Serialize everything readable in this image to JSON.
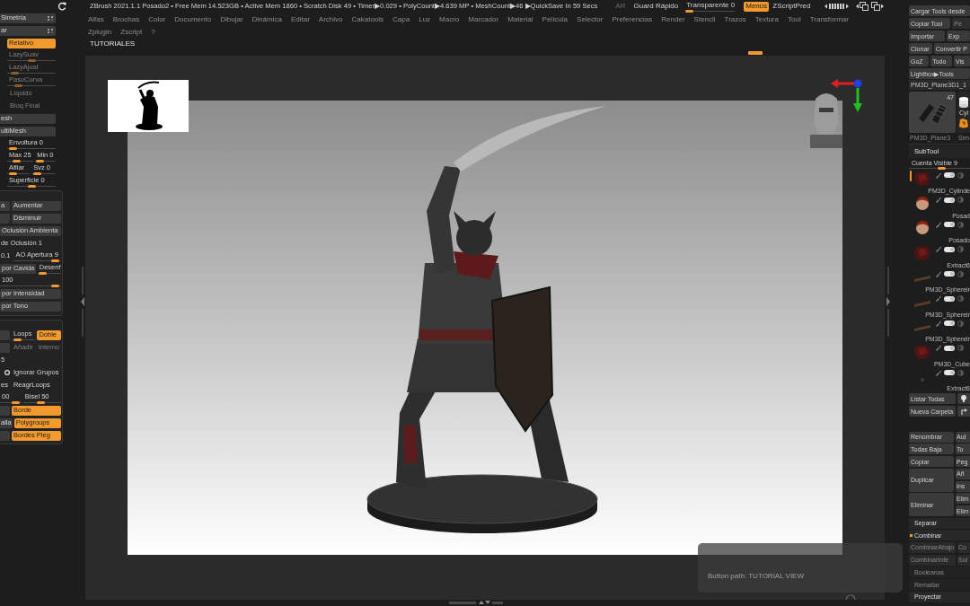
{
  "status_bar": {
    "text": "ZBrush 2021.1.1 Posado2 • Free Mem 14.523GB • Active Mem 1860 • Scratch Disk 49 • Timer▶0.029 • PolyCount▶4.639 MP • MeshCount▶46 ▶QuickSave In 59 Secs",
    "ar": {
      "label": "AR",
      "disabled": true
    },
    "quick_save": "Guard Rápido",
    "transparency": {
      "label": "Transparente 0",
      "level": 0
    },
    "menus": {
      "label": "Menús",
      "on": true
    },
    "zscript": "ZScriptPred"
  },
  "menu_bar": {
    "rows": [
      [
        "Alfas",
        "Brochas",
        "Color",
        "Documento",
        "Dibujar",
        "Dinámica",
        "Editar",
        "Archivo",
        "Cakatools",
        "Capa",
        "Luz",
        "Macro",
        "Marcador",
        "Material",
        "Película",
        "Selector",
        "Preferencias",
        "Render",
        "Stencil",
        "Trazos",
        "Textura",
        "Tool",
        "Transformar"
      ],
      [
        "Zplugin",
        "Zscript",
        "?"
      ]
    ]
  },
  "tab_label": "TUTORIALES",
  "left_tray": {
    "panels": [
      {
        "rows": [
          [
            {
              "kind": "title",
              "label": "Simetría"
            }
          ],
          [
            {
              "kind": "title",
              "label": "ar"
            }
          ],
          [
            {
              "kind": "toggle",
              "label": "Relativo",
              "on": true,
              "disabled": false
            }
          ],
          [
            {
              "kind": "slider",
              "label": "LazySuav",
              "level": 0.5,
              "disabled": true
            }
          ],
          [
            {
              "kind": "slider",
              "label": "LazyAjust",
              "level": 0.08,
              "disabled": true
            }
          ],
          [
            {
              "kind": "slider",
              "label": "PasoCurva",
              "level": 0.18,
              "disabled": true
            }
          ],
          [
            {
              "kind": "button",
              "label": "Líquido",
              "disabled": true
            }
          ],
          [
            {
              "kind": "button",
              "label": "Bloq Final",
              "disabled": true
            }
          ],
          [
            {
              "kind": "bar",
              "label": "esh"
            }
          ],
          [
            {
              "kind": "bar",
              "label": "ultiMesh"
            }
          ],
          [
            {
              "kind": "slider",
              "label": "Envoltura 0",
              "level": 0.05,
              "disabled": false
            }
          ],
          [
            {
              "kind": "slider",
              "label": "Max 25",
              "level": 0.3,
              "disabled": false
            },
            {
              "kind": "slider",
              "label": "Min 0",
              "level": 0.05,
              "disabled": false
            }
          ],
          [
            {
              "kind": "slider",
              "label": "Afilar",
              "level": 0.15,
              "disabled": false
            },
            {
              "kind": "slider",
              "label": "Svz 0",
              "level": 0.1,
              "disabled": false
            }
          ],
          [
            {
              "kind": "slider",
              "label": "Superficie 0",
              "level": 0.5,
              "disabled": false
            }
          ]
        ]
      },
      {
        "rows": [
          [
            {
              "kind": "stub",
              "label": "a"
            },
            {
              "kind": "button",
              "label": "Aumentar",
              "disabled": false
            }
          ],
          [
            {
              "kind": "stub"
            },
            {
              "kind": "button",
              "label": "Disminuir",
              "disabled": false
            }
          ],
          [
            {
              "kind": "button",
              "label": "Oclusión Ambienta",
              "disabled": false
            }
          ],
          [
            {
              "kind": "value",
              "label": "de Oclusión 1"
            }
          ],
          [
            {
              "kind": "value",
              "label": "0.1"
            },
            {
              "kind": "slider",
              "label": "AO Apertura 9",
              "level": 0.95,
              "disabled": false
            }
          ],
          [
            {
              "kind": "button",
              "label": "por Cavida",
              "disabled": false
            },
            {
              "kind": "slider",
              "label": "Desenf",
              "level": 0.1,
              "disabled": false
            }
          ],
          [
            {
              "kind": "slider",
              "label": "100",
              "level": 0.97,
              "disabled": false
            }
          ],
          [
            {
              "kind": "button",
              "label": "por Intensidad",
              "disabled": false
            }
          ],
          [
            {
              "kind": "button",
              "label": "por Tono",
              "disabled": false
            }
          ]
        ]
      },
      {
        "rows": [
          [
            {
              "kind": "stub"
            },
            {
              "kind": "slider",
              "label": "Loops",
              "level": 0.1,
              "disabled": false
            },
            {
              "kind": "toggle",
              "label": "Doble",
              "on": true,
              "disabled": false
            }
          ],
          [
            {
              "kind": "stub"
            },
            {
              "kind": "label",
              "label": "Añadir",
              "disabled": true
            },
            {
              "kind": "label",
              "label": "Interno",
              "disabled": true
            }
          ],
          [
            {
              "kind": "value",
              "label": "5"
            }
          ],
          [
            {
              "kind": "check",
              "checked": false
            },
            {
              "kind": "label",
              "label": "Ignorar Grupos",
              "disabled": false
            }
          ],
          [
            {
              "kind": "value",
              "label": "es"
            },
            {
              "kind": "label",
              "label": "ReagrLoops",
              "disabled": false
            }
          ],
          [
            {
              "kind": "slider",
              "label": "00",
              "level": 0.9,
              "disabled": false
            },
            {
              "kind": "slider",
              "label": "Bisel 50",
              "level": 0.45,
              "disabled": false
            }
          ],
          [
            {
              "kind": "stub"
            },
            {
              "kind": "toggle",
              "label": "Borde",
              "on": true,
              "disabled": false
            }
          ],
          [
            {
              "kind": "stub",
              "label": "alla"
            },
            {
              "kind": "toggle",
              "label": "Polygroups",
              "on": true,
              "disabled": false
            }
          ],
          [
            {
              "kind": "stub"
            },
            {
              "kind": "toggle",
              "label": "Bordes Pleg",
              "on": true,
              "disabled": false
            }
          ]
        ]
      }
    ]
  },
  "viewport": {
    "tooltip": "Button path: TUTORIAL VIEW"
  },
  "right_tray": {
    "tool_rows": [
      [
        {
          "label": "Cargar Tools desde",
          "disabled": false
        }
      ],
      [
        {
          "label": "Copiar Tool",
          "disabled": false
        },
        {
          "label": "Pe",
          "disabled": true
        }
      ],
      [
        {
          "label": "Importar",
          "disabled": false
        },
        {
          "label": "Exp",
          "disabled": false
        }
      ],
      [
        {
          "label": "Clonar",
          "disabled": false
        },
        {
          "label": "Convertir P",
          "disabled": false
        }
      ],
      [
        {
          "label": "GoZ",
          "disabled": false
        },
        {
          "label": "Todo",
          "disabled": false
        },
        {
          "label": "Vis",
          "disabled": false
        }
      ],
      [
        {
          "label": "Lightbox▶Tools",
          "disabled": false
        }
      ]
    ],
    "tool_name": "PM3D_Plane3D1_1",
    "tools": [
      {
        "kind": "parts",
        "count": "47",
        "label": "PM3D_Plane3",
        "selected": true
      },
      {
        "kind": "cylinder",
        "caption": "Cyl",
        "label": "Sim",
        "selected": false
      }
    ],
    "subtool": {
      "title": "SubTool",
      "visible_count": {
        "label": "Cuenta Visible 9",
        "level": 0.55
      },
      "items": [
        {
          "kind": "cloth",
          "selected": true,
          "visible": true
        },
        {
          "name": "PM3D_Cylinde",
          "kind": "head",
          "selected": false,
          "visible": true
        },
        {
          "name": "Posad",
          "kind": "head",
          "selected": false,
          "visible": true
        },
        {
          "name": "Posado",
          "kind": "cloth",
          "selected": false,
          "visible": true
        },
        {
          "name": "Extract6",
          "kind": "strap",
          "selected": false,
          "visible": true
        },
        {
          "name": "PM3D_Sphereir",
          "kind": "strap",
          "selected": false,
          "visible": true
        },
        {
          "name": "PM3D_Sphereir",
          "kind": "strap",
          "selected": false,
          "visible": true
        },
        {
          "name": "PM3D_Sphereir",
          "kind": "cloth",
          "selected": false,
          "visible": true
        },
        {
          "name": "PM3D_Cube",
          "kind": "dot",
          "selected": false,
          "visible": true
        },
        {
          "name": "Extract6",
          "selected": false
        }
      ],
      "list_buttons": [
        "Listar Todas",
        "Nueva Carpeta"
      ],
      "actions": [
        {
          "main": "Renombrar",
          "side": [
            "Aut"
          ]
        },
        {
          "main": "Todas Baja",
          "side": [
            "To"
          ]
        },
        {
          "main": "Copiar",
          "side": [
            "Peg"
          ]
        },
        {
          "main": "Duplicar",
          "side": [
            "Añ",
            "Ins"
          ]
        },
        {
          "main": "Eliminar",
          "side": [
            "Elim",
            "Elim"
          ]
        }
      ]
    },
    "sections": [
      {
        "kind": "title",
        "label": "Separar",
        "expanded": false,
        "disabled": false
      },
      {
        "kind": "title",
        "label": "Combinar",
        "expanded": true,
        "disabled": false
      },
      {
        "kind": "pair",
        "labels": [
          "CombinarAbajo",
          "Co"
        ],
        "disabled": true
      },
      {
        "kind": "pair",
        "labels": [
          "CombinarInfe",
          "Sol"
        ],
        "disabled": true
      },
      {
        "kind": "title",
        "label": "Booleanas",
        "expanded": false,
        "disabled": true
      },
      {
        "kind": "title",
        "label": "Remallar",
        "expanded": false,
        "disabled": true
      },
      {
        "kind": "title",
        "label": "Proyectar",
        "expanded": false,
        "disabled": false
      }
    ]
  }
}
